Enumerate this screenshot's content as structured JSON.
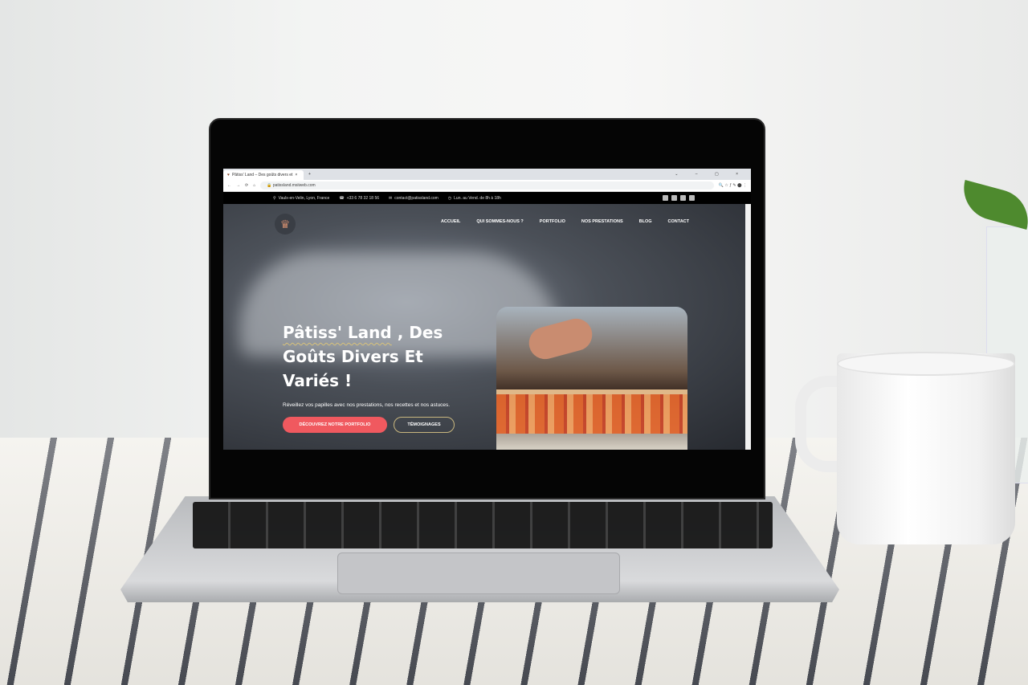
{
  "browser": {
    "tab_title": "Pâtiss' Land – Des goûts divers et",
    "url": "patissland.msiiweb.com"
  },
  "topbar": {
    "address": "Vaulx-en-Velin, Lyon, France",
    "phone": "+33 6 78 32 18 56",
    "email": "contact@patissland.com",
    "hours": "Lun. au Vend. de 8h à 18h"
  },
  "nav": [
    "ACCUEIL",
    "QUI SOMMES-NOUS ?",
    "PORTFOLIO",
    "NOS PRESTATIONS",
    "BLOG",
    "CONTACT"
  ],
  "hero": {
    "title_highlight": "Pâtiss' Land",
    "title_rest": " , Des Goûts Divers Et Variés !",
    "subtitle": "Réveillez vos papilles avec nos prestations, nos recettes et nos astuces.",
    "cta_primary": "DÉCOUVREZ NOTRE PORTFOLIO",
    "cta_secondary": "TÉMOIGNAGES"
  },
  "colors": {
    "accent": "#f0595f",
    "highlight": "#d8c27a"
  }
}
